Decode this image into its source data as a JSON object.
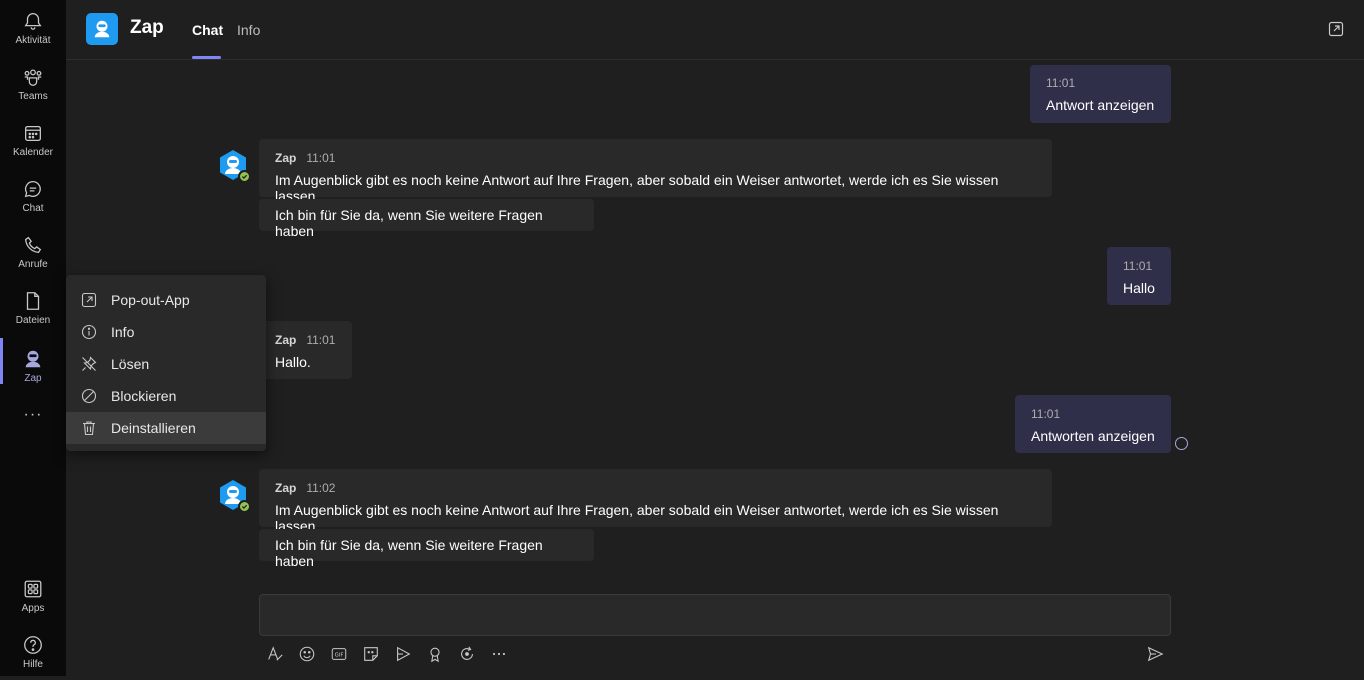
{
  "rail": {
    "items": [
      {
        "label": "Aktivität",
        "icon": "bell-icon"
      },
      {
        "label": "Teams",
        "icon": "teams-icon"
      },
      {
        "label": "Kalender",
        "icon": "calendar-icon"
      },
      {
        "label": "Chat",
        "icon": "chat-icon"
      },
      {
        "label": "Anrufe",
        "icon": "phone-icon"
      },
      {
        "label": "Dateien",
        "icon": "file-icon"
      },
      {
        "label": "Zap",
        "icon": "zap-bot-icon",
        "active": true
      }
    ],
    "more": "···",
    "bottom": [
      {
        "label": "Apps",
        "icon": "apps-icon"
      },
      {
        "label": "Hilfe",
        "icon": "help-icon"
      }
    ]
  },
  "header": {
    "title": "Zap",
    "tabs": [
      {
        "label": "Chat",
        "active": true
      },
      {
        "label": "Info",
        "active": false
      }
    ]
  },
  "messages": [
    {
      "direction": "out",
      "time": "11:01",
      "text": "Antwort anzeigen"
    },
    {
      "direction": "in",
      "sender": "Zap",
      "time": "11:01",
      "text": "Im Augenblick gibt es noch keine Antwort auf Ihre Fragen, aber sobald ein Weiser antwortet, werde ich es Sie wissen lassen.",
      "followup": "Ich bin für Sie da, wenn Sie weitere Fragen haben"
    },
    {
      "direction": "out",
      "time": "11:01",
      "text": "Hallo"
    },
    {
      "direction": "in",
      "sender": "Zap",
      "time": "11:01",
      "text": "Hallo."
    },
    {
      "direction": "out",
      "time": "11:01",
      "text": "Antworten anzeigen"
    },
    {
      "direction": "in",
      "sender": "Zap",
      "time": "11:02",
      "text": "Im Augenblick gibt es noch keine Antwort auf Ihre Fragen, aber sobald ein Weiser antwortet, werde ich es Sie wissen lassen.",
      "followup": "Ich bin für Sie da, wenn Sie weitere Fragen haben"
    }
  ],
  "context_menu": {
    "items": [
      {
        "label": "Pop-out-App",
        "icon": "popout-icon"
      },
      {
        "label": "Info",
        "icon": "info-icon"
      },
      {
        "label": "Lösen",
        "icon": "unpin-icon"
      },
      {
        "label": "Blockieren",
        "icon": "block-icon"
      },
      {
        "label": "Deinstallieren",
        "icon": "trash-icon"
      }
    ]
  },
  "compose": {
    "placeholder": "",
    "tools": [
      "format-icon",
      "emoji-icon",
      "gif-icon",
      "sticker-icon",
      "meet-icon",
      "praise-icon",
      "loop-icon",
      "more-icon"
    ],
    "send_icon": "send-icon"
  },
  "colors": {
    "accent": "#7f85f5",
    "bot_blue": "#1e9bf0",
    "presence_green": "#92c353",
    "outgoing_bubble": "#2f2f4a",
    "incoming_bubble": "#292929"
  }
}
